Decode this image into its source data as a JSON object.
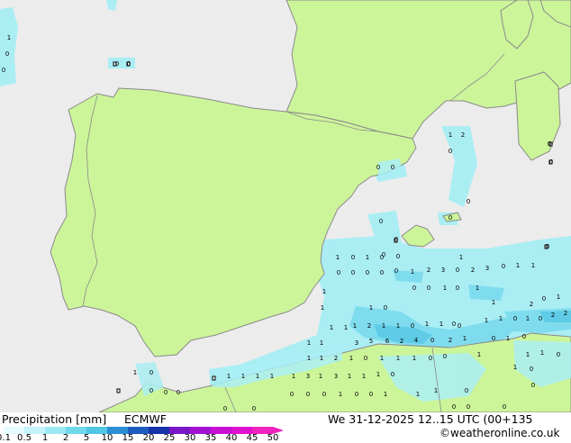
{
  "title": "Precipitation [mm]",
  "model": "ECMWF",
  "valid_time": "We 31-12-2025 12..15 UTC (00+135",
  "credit": "©weatheronline.co.uk",
  "colors": {
    "sea": "#ececec",
    "land": "#ccf59a",
    "coast": "#8a8a8a",
    "precip_light": "#aaeef4",
    "precip_mid": "#7fdcee",
    "precip_heavy": "#5fcbe6"
  },
  "scale": {
    "labels": [
      "0.1",
      "0.5",
      "1",
      "2",
      "5",
      "10",
      "15",
      "20",
      "25",
      "30",
      "35",
      "40",
      "45",
      "50"
    ],
    "colors": [
      "#e6fbfd",
      "#c4f3f8",
      "#9be8f2",
      "#6fd8ea",
      "#4fc6e3",
      "#2a8fd4",
      "#1d5bbf",
      "#1531a8",
      "#7818c8",
      "#a212d2",
      "#c80fd4",
      "#de12cf",
      "#ee22bd"
    ]
  },
  "map_values": [
    {
      "v": "1"
    },
    {
      "v": "0"
    },
    {
      "v": "0"
    },
    {
      "v": "0"
    },
    {
      "v": "0"
    },
    {
      "v": "1"
    },
    {
      "v": "2"
    },
    {
      "v": "0"
    },
    {
      "v": "0"
    },
    {
      "v": "0"
    },
    {
      "v": "0"
    },
    {
      "v": "0"
    },
    {
      "v": "0"
    },
    {
      "v": "0"
    },
    {
      "v": "0"
    },
    {
      "v": "0"
    },
    {
      "v": "0"
    },
    {
      "v": "0"
    },
    {
      "v": "0"
    },
    {
      "v": "1"
    },
    {
      "v": "1"
    },
    {
      "v": "0"
    },
    {
      "v": "1"
    },
    {
      "v": "0"
    },
    {
      "v": "0"
    },
    {
      "v": "0"
    },
    {
      "v": "0"
    },
    {
      "v": "0"
    },
    {
      "v": "2"
    },
    {
      "v": "3"
    },
    {
      "v": "0"
    },
    {
      "v": "2"
    },
    {
      "v": "3"
    },
    {
      "v": "0"
    },
    {
      "v": "1"
    },
    {
      "v": "1"
    },
    {
      "v": "0"
    },
    {
      "v": "1"
    },
    {
      "v": "1"
    },
    {
      "v": "0"
    },
    {
      "v": "0"
    },
    {
      "v": "1"
    },
    {
      "v": "0"
    },
    {
      "v": "1"
    },
    {
      "v": "1"
    },
    {
      "v": "0"
    },
    {
      "v": "1"
    },
    {
      "v": "1"
    },
    {
      "v": "0"
    },
    {
      "v": "1"
    },
    {
      "v": "2"
    },
    {
      "v": "1"
    },
    {
      "v": "0"
    },
    {
      "v": "1"
    },
    {
      "v": "0"
    },
    {
      "v": "1"
    },
    {
      "v": "2"
    },
    {
      "v": "1"
    },
    {
      "v": "1"
    },
    {
      "v": "0"
    },
    {
      "v": "1"
    },
    {
      "v": "1"
    },
    {
      "v": "0"
    },
    {
      "v": "1"
    },
    {
      "v": "1"
    },
    {
      "v": "2"
    },
    {
      "v": "2"
    },
    {
      "v": "1"
    },
    {
      "v": "0"
    },
    {
      "v": "1"
    },
    {
      "v": "1"
    },
    {
      "v": "3"
    },
    {
      "v": "5"
    },
    {
      "v": "6"
    },
    {
      "v": "2"
    },
    {
      "v": "4"
    },
    {
      "v": "0"
    },
    {
      "v": "2"
    },
    {
      "v": "1"
    },
    {
      "v": "0"
    },
    {
      "v": "1"
    },
    {
      "v": "0"
    },
    {
      "v": "1"
    },
    {
      "v": "1"
    },
    {
      "v": "2"
    },
    {
      "v": "1"
    },
    {
      "v": "0"
    },
    {
      "v": "1"
    },
    {
      "v": "1"
    },
    {
      "v": "1"
    },
    {
      "v": "0"
    },
    {
      "v": "0"
    },
    {
      "v": "1"
    },
    {
      "v": "1"
    },
    {
      "v": "1"
    },
    {
      "v": "0"
    },
    {
      "v": "1"
    },
    {
      "v": "1"
    },
    {
      "v": "1"
    },
    {
      "v": "1"
    },
    {
      "v": "1"
    },
    {
      "v": "3"
    },
    {
      "v": "1"
    },
    {
      "v": "3"
    },
    {
      "v": "1"
    },
    {
      "v": "1"
    },
    {
      "v": "1"
    },
    {
      "v": "0"
    },
    {
      "v": "1"
    },
    {
      "v": "0"
    },
    {
      "v": "0"
    },
    {
      "v": "0"
    },
    {
      "v": "0"
    },
    {
      "v": "1"
    },
    {
      "v": "0"
    },
    {
      "v": "0"
    },
    {
      "v": "1"
    },
    {
      "v": "1"
    },
    {
      "v": "1"
    },
    {
      "v": "0"
    },
    {
      "v": "0"
    },
    {
      "v": "1"
    },
    {
      "v": "0"
    },
    {
      "v": "0"
    },
    {
      "v": "0"
    },
    {
      "v": "0"
    },
    {
      "v": "0"
    },
    {
      "v": "0"
    },
    {
      "v": "0"
    },
    {
      "v": "0"
    },
    {
      "v": "0"
    }
  ]
}
